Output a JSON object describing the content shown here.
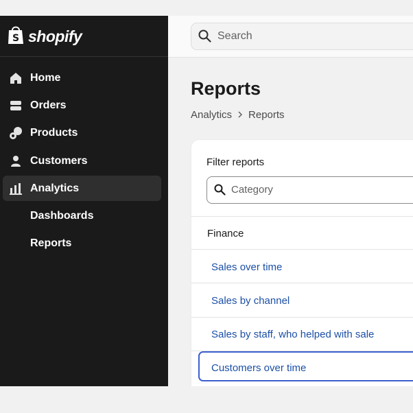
{
  "brand": {
    "logo_text": "shopify"
  },
  "sidebar": {
    "items": [
      {
        "label": "Home",
        "icon": "home-icon"
      },
      {
        "label": "Orders",
        "icon": "orders-icon"
      },
      {
        "label": "Products",
        "icon": "tag-icon"
      },
      {
        "label": "Customers",
        "icon": "person-icon"
      },
      {
        "label": "Analytics",
        "icon": "bar-chart-icon",
        "active": true
      },
      {
        "label": "Dashboards"
      },
      {
        "label": "Reports"
      }
    ]
  },
  "search": {
    "placeholder": "Search"
  },
  "page": {
    "title": "Reports",
    "breadcrumb": [
      "Analytics",
      "Reports"
    ]
  },
  "filter": {
    "label": "Filter reports",
    "placeholder": "Category"
  },
  "reports": {
    "section": "Finance",
    "items": [
      "Sales over time",
      "Sales by channel",
      "Sales by staff, who helped with sale",
      "Customers over time"
    ]
  },
  "colors": {
    "sidebar_bg": "#1a1a1a",
    "link": "#1b4fa6",
    "selection_border": "#3c5fcf"
  }
}
